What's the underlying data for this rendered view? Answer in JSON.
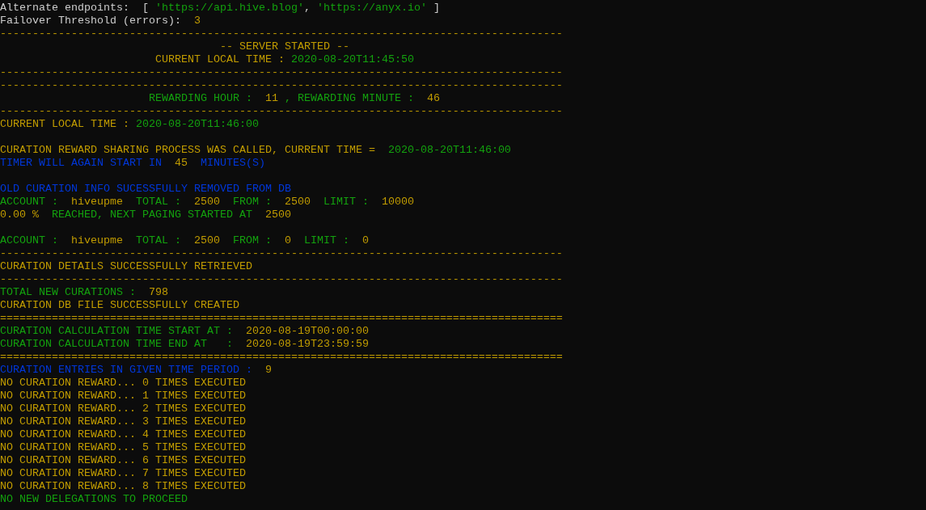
{
  "terminal": {
    "lines": [
      {
        "kind": "text",
        "segments": [
          {
            "text": "Alternate endpoints:  [ ",
            "kind": "plain"
          },
          {
            "text": "'https://api.hive.blog'",
            "kind": "ok"
          },
          {
            "text": ", ",
            "kind": "plain"
          },
          {
            "text": "'https://anyx.io'",
            "kind": "ok"
          },
          {
            "text": " ]",
            "kind": "plain"
          }
        ]
      },
      {
        "kind": "text",
        "segments": [
          {
            "text": "Failover Threshold (errors):  ",
            "kind": "plain"
          },
          {
            "text": "3",
            "kind": "warn"
          }
        ]
      },
      {
        "kind": "text",
        "segments": [
          {
            "text": "---------------------------------------------------------------------------------------",
            "kind": "warn"
          }
        ]
      },
      {
        "kind": "text",
        "segments": [
          {
            "text": "                                  -- SERVER STARTED --",
            "kind": "warn"
          }
        ]
      },
      {
        "kind": "text",
        "segments": [
          {
            "text": "                        CURRENT LOCAL TIME : ",
            "kind": "warn"
          },
          {
            "text": "2020-08-20T11:45:50",
            "kind": "ok"
          }
        ]
      },
      {
        "kind": "text",
        "segments": [
          {
            "text": "---------------------------------------------------------------------------------------",
            "kind": "warn"
          }
        ]
      },
      {
        "kind": "text",
        "segments": [
          {
            "text": "---------------------------------------------------------------------------------------",
            "kind": "warn"
          }
        ]
      },
      {
        "kind": "text",
        "segments": [
          {
            "text": "                       REWARDING HOUR :  ",
            "kind": "ok"
          },
          {
            "text": "11",
            "kind": "warn"
          },
          {
            "text": " , REWARDING MINUTE :  ",
            "kind": "ok"
          },
          {
            "text": "46",
            "kind": "warn"
          }
        ]
      },
      {
        "kind": "text",
        "segments": [
          {
            "text": "---------------------------------------------------------------------------------------",
            "kind": "warn"
          }
        ]
      },
      {
        "kind": "text",
        "segments": [
          {
            "text": "CURRENT LOCAL TIME : ",
            "kind": "warn"
          },
          {
            "text": "2020-08-20T11:46:00",
            "kind": "ok"
          }
        ]
      },
      {
        "kind": "blank"
      },
      {
        "kind": "text",
        "segments": [
          {
            "text": "CURATION REWARD SHARING PROCESS WAS CALLED, CURRENT TIME =  ",
            "kind": "warn"
          },
          {
            "text": "2020-08-20T11:46:00",
            "kind": "ok"
          }
        ]
      },
      {
        "kind": "text",
        "segments": [
          {
            "text": "TIMER WILL AGAIN START IN  ",
            "kind": "info"
          },
          {
            "text": "45",
            "kind": "warn"
          },
          {
            "text": "  MINUTES(S)",
            "kind": "info"
          }
        ]
      },
      {
        "kind": "blank"
      },
      {
        "kind": "text",
        "segments": [
          {
            "text": "OLD CURATION INFO SUCESSFULLY REMOVED FROM DB",
            "kind": "info"
          }
        ]
      },
      {
        "kind": "text",
        "segments": [
          {
            "text": "ACCOUNT :  ",
            "kind": "ok"
          },
          {
            "text": "hiveupme",
            "kind": "warn"
          },
          {
            "text": "  TOTAL :  ",
            "kind": "ok"
          },
          {
            "text": "2500",
            "kind": "warn"
          },
          {
            "text": "  FROM :  ",
            "kind": "ok"
          },
          {
            "text": "2500",
            "kind": "warn"
          },
          {
            "text": "  LIMIT :  ",
            "kind": "ok"
          },
          {
            "text": "10000",
            "kind": "warn"
          }
        ]
      },
      {
        "kind": "text",
        "segments": [
          {
            "text": "0.00 %",
            "kind": "warn"
          },
          {
            "text": "  REACHED, NEXT PAGING STARTED AT  ",
            "kind": "ok"
          },
          {
            "text": "2500",
            "kind": "warn"
          }
        ]
      },
      {
        "kind": "blank"
      },
      {
        "kind": "text",
        "segments": [
          {
            "text": "ACCOUNT :  ",
            "kind": "ok"
          },
          {
            "text": "hiveupme",
            "kind": "warn"
          },
          {
            "text": "  TOTAL :  ",
            "kind": "ok"
          },
          {
            "text": "2500",
            "kind": "warn"
          },
          {
            "text": "  FROM :  ",
            "kind": "ok"
          },
          {
            "text": "0",
            "kind": "warn"
          },
          {
            "text": "  LIMIT :  ",
            "kind": "ok"
          },
          {
            "text": "0",
            "kind": "warn"
          }
        ]
      },
      {
        "kind": "text",
        "segments": [
          {
            "text": "---------------------------------------------------------------------------------------",
            "kind": "warn"
          }
        ]
      },
      {
        "kind": "text",
        "segments": [
          {
            "text": "CURATION DETAILS SUCCESSFULLY RETRIEVED",
            "kind": "warn"
          }
        ]
      },
      {
        "kind": "text",
        "segments": [
          {
            "text": "---------------------------------------------------------------------------------------",
            "kind": "warn"
          }
        ]
      },
      {
        "kind": "text",
        "segments": [
          {
            "text": "TOTAL NEW CURATIONS :  ",
            "kind": "ok"
          },
          {
            "text": "798",
            "kind": "warn"
          }
        ]
      },
      {
        "kind": "text",
        "segments": [
          {
            "text": "CURATION DB FILE SUCCESSFULLY CREATED",
            "kind": "warn"
          }
        ]
      },
      {
        "kind": "text",
        "segments": [
          {
            "text": "=======================================================================================",
            "kind": "warn"
          }
        ]
      },
      {
        "kind": "text",
        "segments": [
          {
            "text": "CURATION CALCULATION TIME START AT :  ",
            "kind": "ok"
          },
          {
            "text": "2020-08-19T00:00:00",
            "kind": "warn"
          }
        ]
      },
      {
        "kind": "text",
        "segments": [
          {
            "text": "CURATION CALCULATION TIME END AT   :  ",
            "kind": "ok"
          },
          {
            "text": "2020-08-19T23:59:59",
            "kind": "warn"
          }
        ]
      },
      {
        "kind": "text",
        "segments": [
          {
            "text": "=======================================================================================",
            "kind": "warn"
          }
        ]
      },
      {
        "kind": "text",
        "segments": [
          {
            "text": "CURATION ENTRIES IN GIVEN TIME PERIOD :  ",
            "kind": "info"
          },
          {
            "text": "9",
            "kind": "warn"
          }
        ]
      },
      {
        "kind": "text",
        "segments": [
          {
            "text": "NO CURATION REWARD... 0 TIMES EXECUTED",
            "kind": "warn"
          }
        ]
      },
      {
        "kind": "text",
        "segments": [
          {
            "text": "NO CURATION REWARD... 1 TIMES EXECUTED",
            "kind": "warn"
          }
        ]
      },
      {
        "kind": "text",
        "segments": [
          {
            "text": "NO CURATION REWARD... 2 TIMES EXECUTED",
            "kind": "warn"
          }
        ]
      },
      {
        "kind": "text",
        "segments": [
          {
            "text": "NO CURATION REWARD... 3 TIMES EXECUTED",
            "kind": "warn"
          }
        ]
      },
      {
        "kind": "text",
        "segments": [
          {
            "text": "NO CURATION REWARD... 4 TIMES EXECUTED",
            "kind": "warn"
          }
        ]
      },
      {
        "kind": "text",
        "segments": [
          {
            "text": "NO CURATION REWARD... 5 TIMES EXECUTED",
            "kind": "warn"
          }
        ]
      },
      {
        "kind": "text",
        "segments": [
          {
            "text": "NO CURATION REWARD... 6 TIMES EXECUTED",
            "kind": "warn"
          }
        ]
      },
      {
        "kind": "text",
        "segments": [
          {
            "text": "NO CURATION REWARD... 7 TIMES EXECUTED",
            "kind": "warn"
          }
        ]
      },
      {
        "kind": "text",
        "segments": [
          {
            "text": "NO CURATION REWARD... 8 TIMES EXECUTED",
            "kind": "warn"
          }
        ]
      },
      {
        "kind": "text",
        "segments": [
          {
            "text": "NO NEW DELEGATIONS TO PROCEED",
            "kind": "ok"
          }
        ]
      }
    ]
  }
}
